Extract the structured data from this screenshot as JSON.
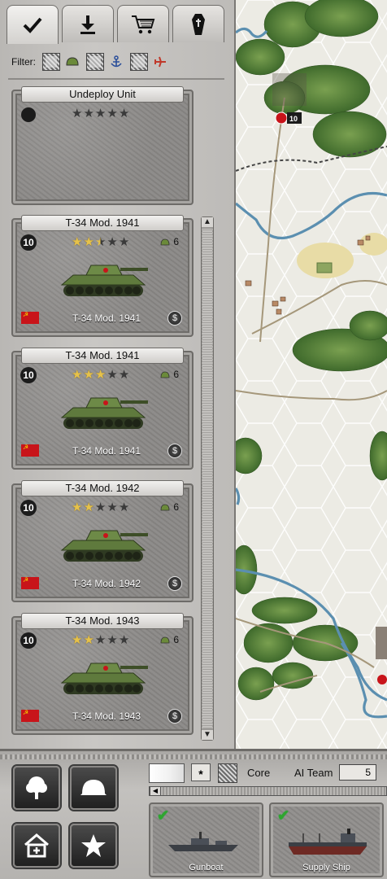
{
  "tabs": [
    {
      "name": "deploy",
      "icon": "checkmark-icon",
      "active": true
    },
    {
      "name": "download",
      "icon": "download-icon",
      "active": false
    },
    {
      "name": "purchase",
      "icon": "shopping-cart-icon",
      "active": false
    },
    {
      "name": "graveyard",
      "icon": "coffin-icon",
      "active": false
    }
  ],
  "filter": {
    "label": "Filter:",
    "options": [
      {
        "name": "ground",
        "icon": "helmet-icon"
      },
      {
        "name": "naval",
        "icon": "anchor-icon"
      },
      {
        "name": "air",
        "icon": "plane-icon"
      }
    ]
  },
  "undeploy_card": {
    "title": "Undeploy Unit",
    "stars": 0
  },
  "unit_cards": [
    {
      "title": "T-34 Mod. 1941",
      "level": "10",
      "stars": 2.5,
      "ammo": "6",
      "caption": "T-34 Mod. 1941",
      "nation": "soviet-flag"
    },
    {
      "title": "T-34 Mod. 1941",
      "level": "10",
      "stars": 3,
      "ammo": "6",
      "caption": "T-34 Mod. 1941",
      "nation": "soviet-flag"
    },
    {
      "title": "T-34 Mod. 1942",
      "level": "10",
      "stars": 2,
      "ammo": "6",
      "caption": "T-34 Mod. 1942",
      "nation": "soviet-flag"
    },
    {
      "title": "T-34 Mod. 1943",
      "level": "10",
      "stars": 2,
      "ammo": "6",
      "caption": "T-34 Mod. 1943",
      "nation": "soviet-flag"
    }
  ],
  "map": {
    "unit_marker_level": "10"
  },
  "bottom": {
    "asterisk": "*",
    "core_label": "Core",
    "ai_team_label": "AI Team",
    "ai_team_value": "5",
    "tool_buttons": [
      {
        "name": "terrain-tree",
        "icon": "tree-icon"
      },
      {
        "name": "unit-helmet",
        "icon": "helmet-icon"
      },
      {
        "name": "add-building",
        "icon": "house-plus-icon"
      },
      {
        "name": "victory-star",
        "icon": "star-icon"
      }
    ],
    "naval_units": [
      {
        "caption": "Gunboat",
        "selected": true
      },
      {
        "caption": "Supply Ship",
        "selected": true
      }
    ]
  },
  "colors": {
    "star_gold": "#e6c24a",
    "soviet_red": "#c8141a",
    "river": "#5b8fb0",
    "forest": "#4f7a35",
    "check_green": "#2fa52f"
  }
}
